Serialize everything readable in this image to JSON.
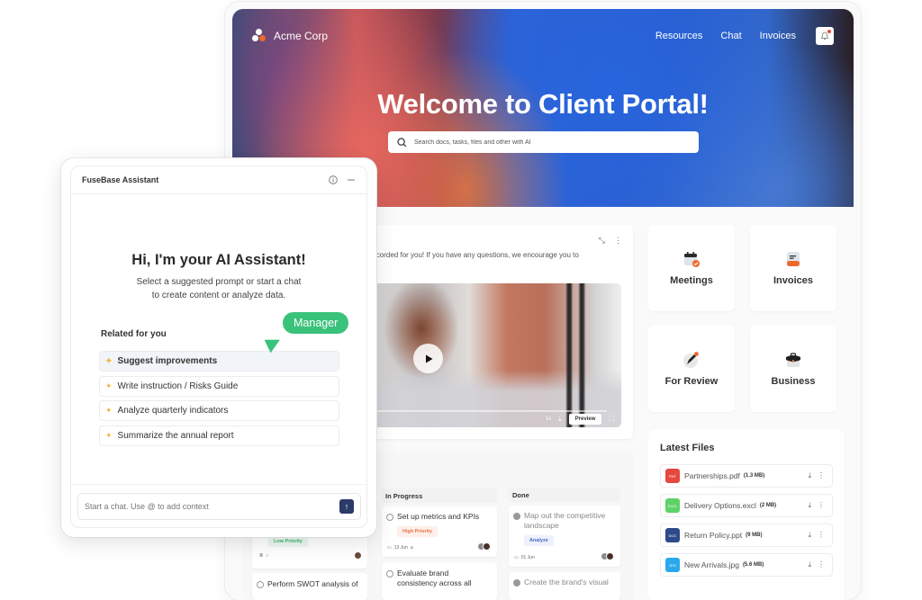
{
  "portal": {
    "brand": "Acme Corp",
    "nav": [
      "Resources",
      "Chat",
      "Invoices"
    ],
    "hero_title": "Welcome to Client Portal!",
    "search_placeholder": "Search docs, tasks, files and other with AI",
    "video": {
      "description": "ve recorded for you! If you have any questions, we encourage you to",
      "speed": "1x",
      "preview_label": "Preview",
      "progress_percent": 2
    },
    "tiles": [
      {
        "label": "Meetings",
        "icon": "calendar-check-icon"
      },
      {
        "label": "Invoices",
        "icon": "invoice-icon"
      },
      {
        "label": "For Review",
        "icon": "pen-icon"
      },
      {
        "label": "Business",
        "icon": "briefcase-icon"
      }
    ],
    "latest_files": {
      "title": "Latest Files",
      "files": [
        {
          "name": "Partnerships.pdf",
          "size": "(1.3 MB)",
          "type": "PDF",
          "color": "#e5483d"
        },
        {
          "name": "Delivery Options.excl",
          "size": "(2 MB)",
          "type": "EXCL",
          "color": "#5fd267"
        },
        {
          "name": "Return Policy.ppt",
          "size": "(9 MB)",
          "type": "DOC",
          "color": "#2f4a8a"
        },
        {
          "name": "New Arrivals.jpg",
          "size": "(5.6 MB)",
          "type": "JPG",
          "color": "#2ba8ec"
        }
      ]
    },
    "kanban": {
      "columns": [
        {
          "name": "In Progress"
        },
        {
          "name": "Done"
        }
      ],
      "todo_tasks": [
        {
          "tag": "Low Priority"
        },
        {
          "title": "Perform SWOT analysis of"
        }
      ],
      "in_progress_tasks": [
        {
          "title": "Set up metrics and KPIs",
          "tag": "High Priority",
          "date": "13 Jun"
        },
        {
          "title": "Evaluate brand consistency across all"
        }
      ],
      "done_tasks": [
        {
          "title": "Map out the competitive landscape",
          "tag": "Analyze",
          "date": "01 Jun"
        },
        {
          "title": "Create the brand's visual"
        }
      ]
    }
  },
  "assistant": {
    "title": "FuseBase Assistant",
    "greeting": "Hi, I'm your AI Assistant!",
    "subtitle_line1": "Select a suggested prompt or start a chat",
    "subtitle_line2": "to create content or analyze data.",
    "related_title": "Related for you",
    "prompts": [
      "Suggest improvements",
      "Write instruction / Risks Guide",
      "Analyze quarterly indicators",
      "Summarize the annual report"
    ],
    "cursor_label": "Manager",
    "chat_placeholder": "Start a chat. Use @ to add context"
  },
  "colors": {
    "manager_green": "#39c27a",
    "send_button": "#2b3a67",
    "high_priority": "#e8744a",
    "low_priority": "#38b873",
    "analyze": "#4a63c9"
  }
}
